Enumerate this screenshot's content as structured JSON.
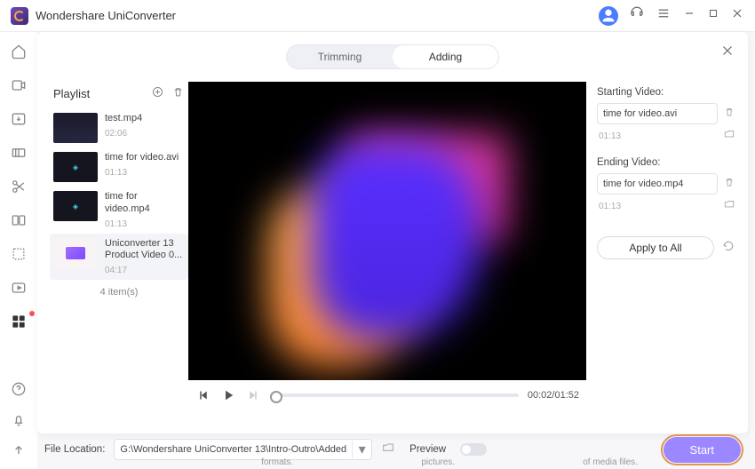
{
  "app": {
    "title": "Wondershare UniConverter"
  },
  "tabs": {
    "trimming": "Trimming",
    "adding": "Adding"
  },
  "playlist": {
    "title": "Playlist",
    "items": [
      {
        "name": "test.mp4",
        "time": "02:06"
      },
      {
        "name": "time for video.avi",
        "time": "01:13"
      },
      {
        "name": "time for video.mp4",
        "time": "01:13"
      },
      {
        "name": "Uniconverter 13 Product Video 0...",
        "time": "04:17"
      }
    ],
    "count_label": "4 item(s)"
  },
  "playback": {
    "timecode": "00:02/01:52"
  },
  "starting": {
    "label": "Starting Video:",
    "value": "time for video.avi",
    "time": "01:13"
  },
  "ending": {
    "label": "Ending Video:",
    "value": "time for video.mp4",
    "time": "01:13"
  },
  "apply_all": "Apply to All",
  "bottom": {
    "file_loc_label": "File Location:",
    "path": "G:\\Wondershare UniConverter 13\\Intro-Outro\\Added",
    "preview_label": "Preview",
    "start": "Start"
  },
  "footer": {
    "formats": "formats.",
    "pictures": "pictures.",
    "media": "of media files."
  }
}
